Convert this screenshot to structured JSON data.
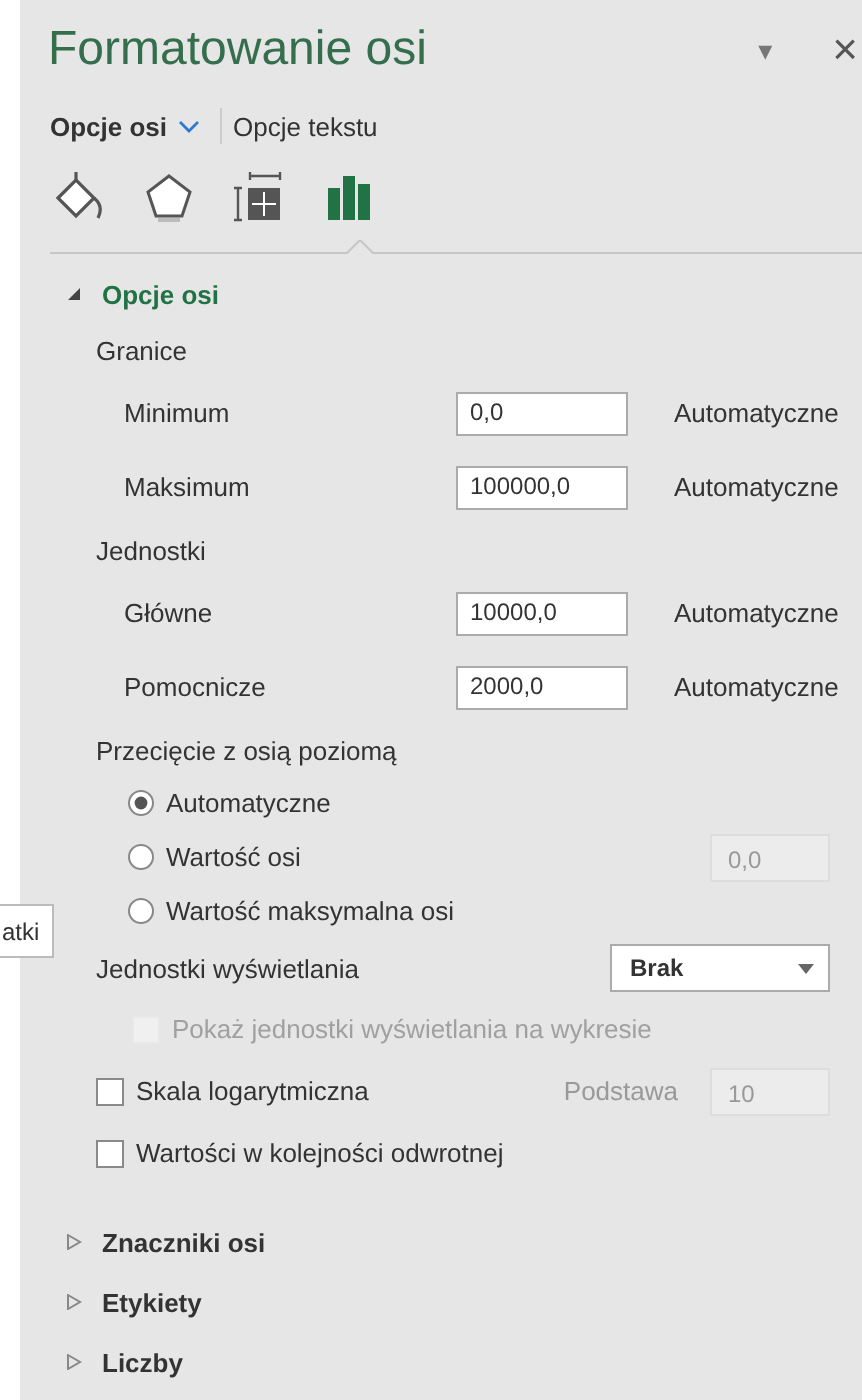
{
  "panel": {
    "title": "Formatowanie osi",
    "menu_icon": "▾",
    "close_icon": "×"
  },
  "tabs": [
    {
      "label": "Opcje osi",
      "selected": true
    },
    {
      "label": "Opcje tekstu",
      "selected": false
    }
  ],
  "icon_tabs": [
    {
      "kind": "fill",
      "selected": false
    },
    {
      "kind": "effects",
      "selected": false
    },
    {
      "kind": "size",
      "selected": false
    },
    {
      "kind": "axis",
      "selected": true
    }
  ],
  "sections": [
    {
      "title": "Opcje osi",
      "expanded": true,
      "items": [
        {
          "kind": "heading",
          "label": "Granice"
        },
        {
          "kind": "number",
          "label": "Minimum",
          "value": "0,0",
          "status": "Automatyczne"
        },
        {
          "kind": "number",
          "label": "Maksimum",
          "value": "100000,0",
          "status": "Automatyczne"
        },
        {
          "kind": "heading",
          "label": "Jednostki"
        },
        {
          "kind": "number",
          "label": "Główne",
          "value": "10000,0",
          "status": "Automatyczne"
        },
        {
          "kind": "number",
          "label": "Pomocnicze",
          "value": "2000,0",
          "status": "Automatyczne"
        },
        {
          "kind": "heading",
          "label": "Przecięcie z osią poziomą"
        },
        {
          "kind": "radio",
          "label": "Automatyczne",
          "selected": true
        },
        {
          "kind": "radio",
          "label": "Wartość osi",
          "selected": false,
          "value": "0,0"
        },
        {
          "kind": "radio",
          "label": "Wartość maksymalna osi",
          "selected": false
        },
        {
          "kind": "dropdown",
          "label": "Jednostki wyświetlania",
          "value": "Brak"
        },
        {
          "kind": "checkbox",
          "label": "Pokaż jednostki wyświetlania na wykresie",
          "checked": false,
          "disabled": true,
          "indent": true
        },
        {
          "kind": "checkbox",
          "label": "Skala logarytmiczna",
          "checked": false,
          "disabled": false,
          "indent": false,
          "side_label": "Podstawa",
          "value": "10"
        },
        {
          "kind": "checkbox",
          "label": "Wartości w kolejności odwrotnej",
          "checked": false,
          "disabled": false,
          "indent": false
        }
      ]
    },
    {
      "title": "Znaczniki osi",
      "expanded": false
    },
    {
      "title": "Etykiety",
      "expanded": false
    },
    {
      "title": "Liczby",
      "expanded": false
    }
  ],
  "tooltip": {
    "text": "atki"
  }
}
